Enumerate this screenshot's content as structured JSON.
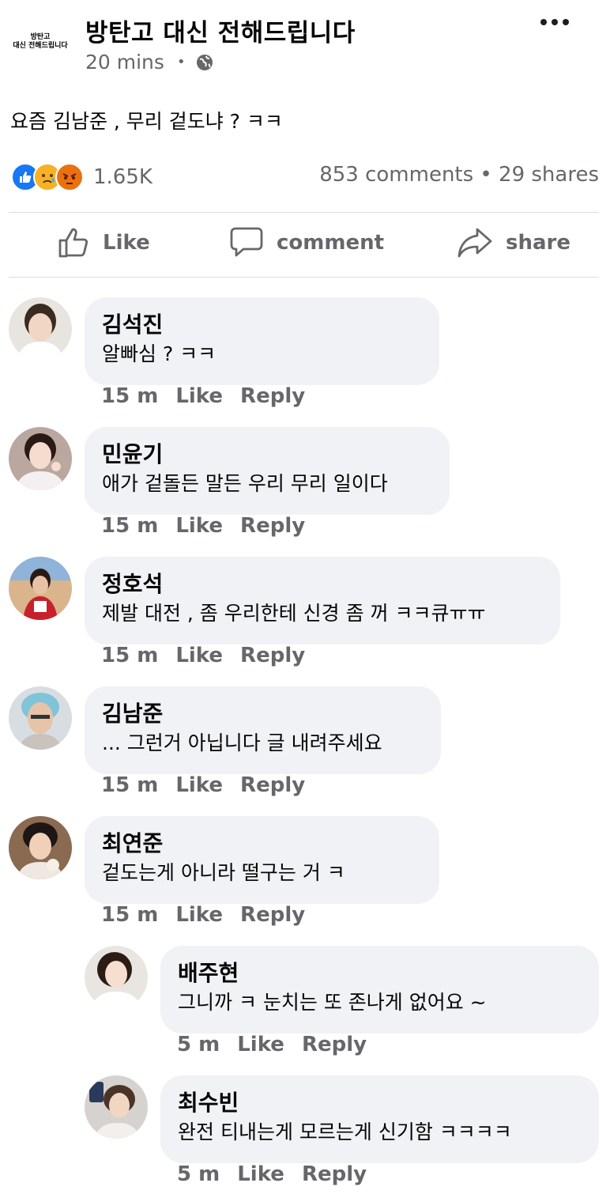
{
  "post": {
    "page_avatar_line1": "방탄고",
    "page_avatar_line2": "대신 전해드립니다",
    "page_name": "방탄고 대신 전해드립니다",
    "time": "20 mins",
    "privacy_icon": "globe-icon",
    "text": "요즘 김남준 , 무리 겉도냐 ? ㅋㅋ",
    "reaction_icons": [
      "like-icon",
      "sad-icon",
      "angry-icon"
    ],
    "reaction_count": "1.65K",
    "comments_shares": "853 comments • 29 shares"
  },
  "actions": {
    "like": "Like",
    "comment": "comment",
    "share": "share"
  },
  "colors": {
    "like_blue": "#1877f2",
    "sad_yellow": "#f7b125",
    "angry_orange": "#e9710f",
    "bubble_bg": "#f0f2f5",
    "meta_gray": "#65676b"
  },
  "comments": [
    {
      "name": "김석진",
      "text": "알빠심 ? ㅋㅋ",
      "time": "15 m",
      "like": "Like",
      "reply": "Reply"
    },
    {
      "name": "민윤기",
      "text": "애가 겉돌든 말든 우리 무리 일이다",
      "time": "15 m",
      "like": "Like",
      "reply": "Reply"
    },
    {
      "name": "정호석",
      "text": "제발 대전 , 좀 우리한테 신경 좀 꺼 ㅋㅋ큐ㅠㅠ",
      "time": "15 m",
      "like": "Like",
      "reply": "Reply"
    },
    {
      "name": "김남준",
      "text": "... 그런거 아닙니다 글 내려주세요",
      "time": "15 m",
      "like": "Like",
      "reply": "Reply"
    },
    {
      "name": "최연준",
      "text": "겉도는게 아니라 떨구는 거 ㅋ",
      "time": "15 m",
      "like": "Like",
      "reply": "Reply"
    }
  ],
  "replies": [
    {
      "name": "배주현",
      "text": "그니까 ㅋ 눈치는 또 존나게 없어요 ~",
      "time": "5 m",
      "like": "Like",
      "reply": "Reply"
    },
    {
      "name": "최수빈",
      "text": "완전 티내는게 모르는게 신기함 ㅋㅋㅋㅋ",
      "time": "5 m",
      "like": "Like",
      "reply": "Reply"
    }
  ]
}
